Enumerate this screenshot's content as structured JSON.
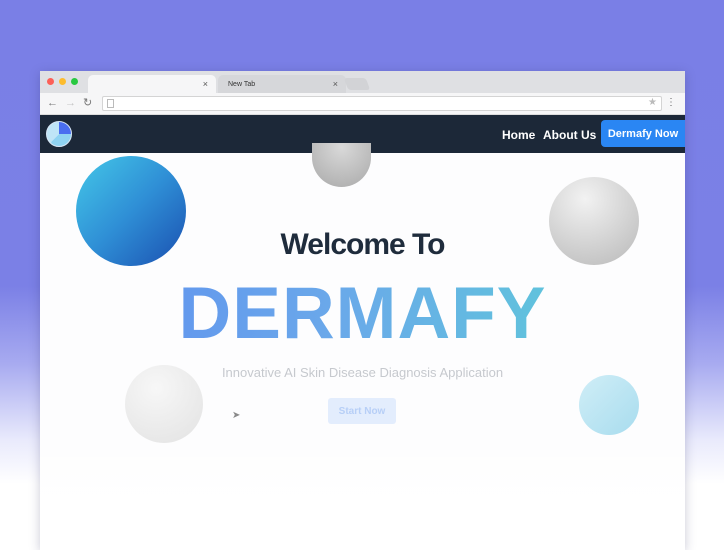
{
  "browser": {
    "tabs": [
      {
        "title": "",
        "close": "×"
      },
      {
        "title": "New Tab",
        "close": "×"
      }
    ],
    "nav": {
      "back": "←",
      "forward": "→",
      "reload": "↻"
    },
    "address_value": "",
    "menu_icon": "⋮",
    "star_icon": "★"
  },
  "site": {
    "nav": {
      "home": "Home",
      "about": "About Us",
      "cta": "Dermafy Now"
    },
    "hero": {
      "welcome": "Welcome To",
      "brand": "DERMAFY",
      "subtitle": "Innovative AI Skin Disease Diagnosis Application",
      "start": "Start Now"
    }
  },
  "colors": {
    "navbar": "#1c2838",
    "cta": "#2a86f3",
    "brand_gradient_start": "#5d8cf0",
    "brand_gradient_end": "#5ad3d4"
  }
}
